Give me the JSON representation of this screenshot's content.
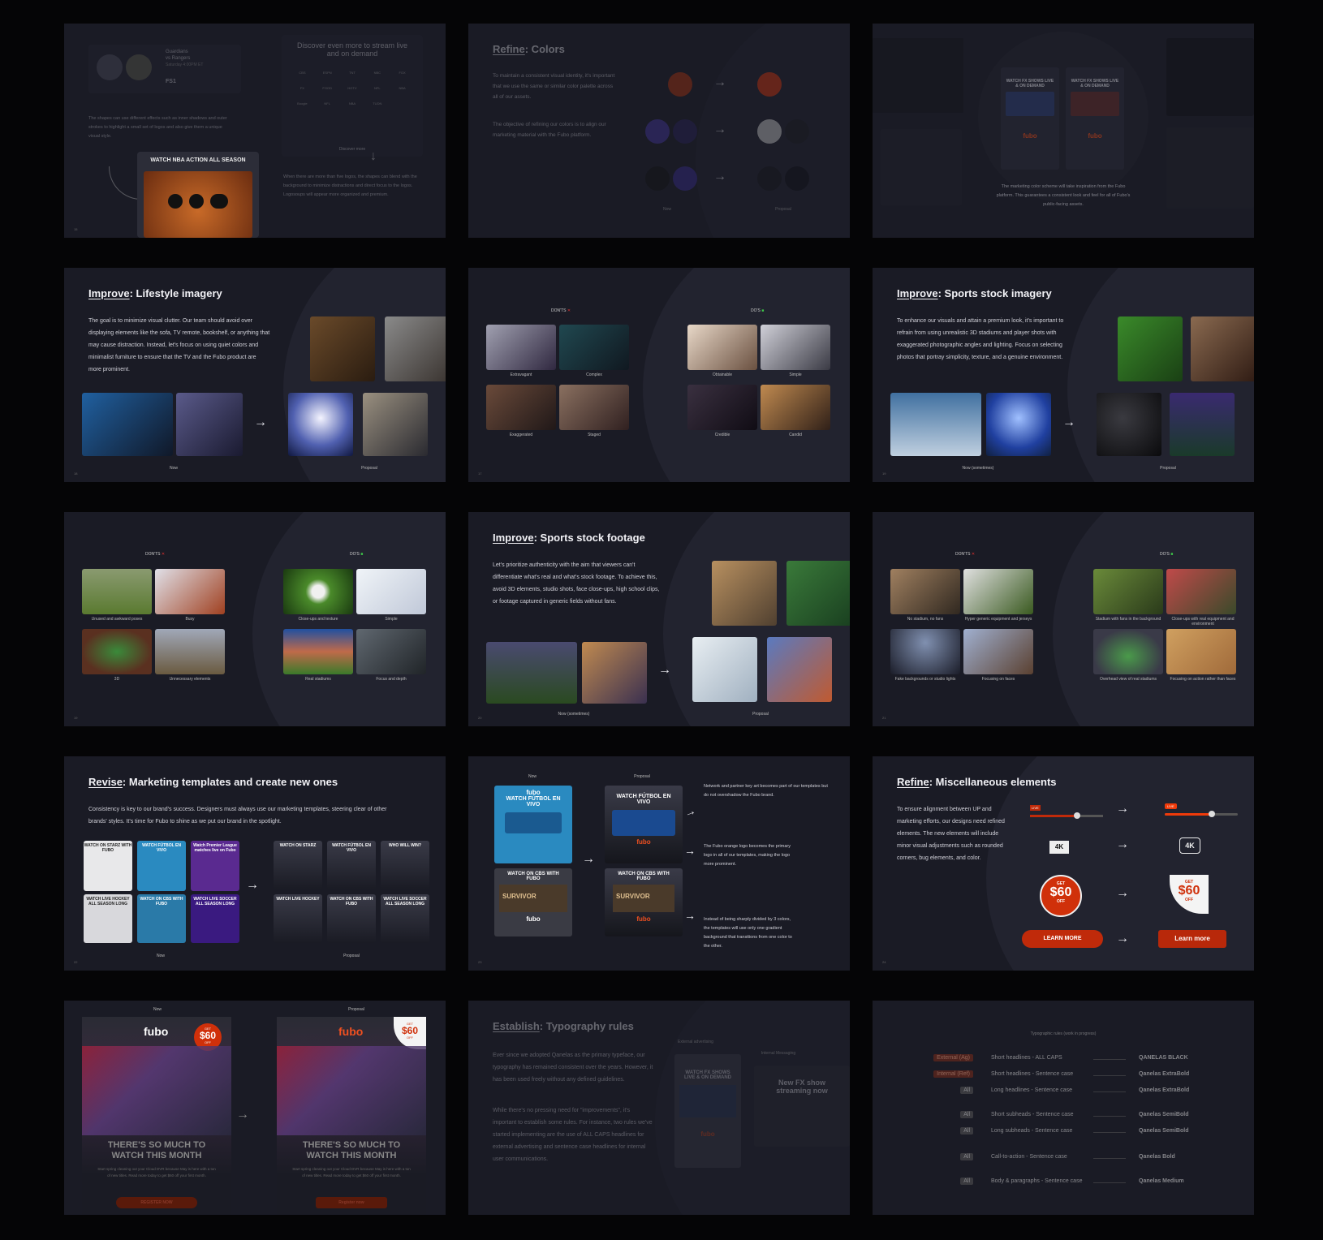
{
  "s1": {
    "game_line1": "Guardians",
    "game_line2": "vs Rangers",
    "game_time": "Saturday 4:00PM ET",
    "network": "FS1",
    "discover_title": "Discover even more to stream live and on demand",
    "discover_link": "Discover more",
    "shapes_text": "The shapes can use different effects such as inner shadows and outer strokes to highlight a small set of logos and also give them a unique visual style.",
    "nba_label": "WATCH NBA ACTION ALL SEASON",
    "blend_text": "When there are more than five logos, the shapes can blend with the background to minimize distractions and direct focus to the logos. Logosoups will appear more organized and premium.",
    "logo_labels": [
      "CBS",
      "ESPN",
      "TNT",
      "NBC",
      "FOX",
      "FX",
      "FOOD",
      "HGTV",
      "NFL",
      "NBA",
      "Boogie",
      "NFL",
      "NBA",
      "TUDN"
    ]
  },
  "s2": {
    "title_prefix": "Refine",
    "title_suffix": ": Colors",
    "p1": "To maintain a consistent visual identity, it's important that we use the same or similar color palette across all of our assets.",
    "p2": "The objective of refining our colors is to align our marketing material with the Fubo platform.",
    "now_label": "Now",
    "proposal_label": "Proposal"
  },
  "s3": {
    "watch_fx": "WATCH FX SHOWS LIVE & ON DEMAND",
    "brand": "fubo",
    "caption": "The marketing color scheme will take inspiration from the Fubo platform. This guarantees a consistent look and feel for all of Fubo's public-facing assets."
  },
  "s4": {
    "title_prefix": "Improve",
    "title_suffix": ": Lifestyle imagery",
    "body": "The goal is to minimize visual clutter. Our team should avoid over displaying elements like the sofa, TV remote, bookshelf, or anything that may cause distraction. Instead, let's focus on using quiet colors and minimalist furniture to ensure that the TV and the Fubo product are more prominent.",
    "now_label": "Now",
    "proposal_label": "Proposal"
  },
  "s5": {
    "donts": "DON'TS",
    "dos": "DO'S",
    "captions_bad": [
      "Extravagant",
      "Complex",
      "Exaggerated",
      "Staged"
    ],
    "captions_good": [
      "Obtainable",
      "Simple",
      "Credible",
      "Candid"
    ]
  },
  "s6": {
    "title_prefix": "Improve",
    "title_suffix": ": Sports stock imagery",
    "body": "To enhance our visuals and attain a premium look, it's important to refrain from using unrealistic 3D stadiums and player shots with exaggerated photographic angles and lighting. Focus on selecting photos that portray simplicity, texture, and a genuine environment.",
    "now_label": "Now (sometimes)",
    "proposal_label": "Proposal"
  },
  "s7": {
    "donts": "DON'TS",
    "dos": "DO'S",
    "captions_bad": [
      "Unused and awkward poses",
      "Busy",
      "3D",
      "Unnecessary elements"
    ],
    "captions_good": [
      "Close-ups and texture",
      "Simple",
      "Real stadiums",
      "Focus and depth"
    ]
  },
  "s8": {
    "title_prefix": "Improve",
    "title_suffix": ": Sports stock footage",
    "body": "Let's prioritize authenticity with the aim that viewers can't differentiate what's real and what's stock footage. To achieve this, avoid 3D elements, studio shots, face close-ups, high school clips, or footage captured in generic fields without fans.",
    "now_label": "Now (sometimes)",
    "proposal_label": "Proposal"
  },
  "s9": {
    "donts": "DON'TS",
    "dos": "DO'S",
    "captions_bad": [
      "No stadium, no fans",
      "Hyper generic equipment and jerseys",
      "Fake backgrounds or studio lights",
      "Focusing on faces"
    ],
    "captions_good": [
      "Stadium with fans in the background",
      "Close-ups with real equipment and environment",
      "Overhead view of real stadiums",
      "Focusing on action rather than faces"
    ]
  },
  "s10": {
    "title_prefix": "Revise",
    "title_suffix": ": Marketing templates and create new ones",
    "body": "Consistency is key to our brand's success. Designers must always use our marketing templates, steering clear of other brands' styles. It's time for Fubo to shine as we put our brand in the spotlight.",
    "now_label": "Now",
    "proposal_label": "Proposal",
    "tiles_now": [
      "WATCH ON STARZ WITH FUBO",
      "WATCH FÚTBOL EN VIVO",
      "Watch Premier League matches live on Fubo",
      "WATCH LIVE HOCKEY ALL SEASON LONG",
      "WATCH ON CBS WITH FUBO",
      "WATCH LIVE SOCCER ALL SEASON LONG"
    ],
    "tiles_prop": [
      "WATCH ON STARZ",
      "WATCH FÚTBOL EN VIVO",
      "WHO WILL WIN?",
      "WATCH LIVE HOCKEY",
      "WATCH ON CBS WITH FUBO",
      "WATCH LIVE SOCCER ALL SEASON LONG"
    ]
  },
  "s11": {
    "now_label": "Now",
    "proposal_label": "Proposal",
    "futbol": "WATCH FÚTBOL EN VIVO",
    "cbs": "WATCH ON CBS WITH FUBO",
    "survivor": "SURVIVOR",
    "brand": "fubo",
    "note1": "Network and partner key art becomes part of our templates but do not overshadow the Fubo brand.",
    "note2": "The Fubo orange logo becomes the primary logo in all of our templates, making the logo more prominent.",
    "note3": "Instead of being sharply divided by 3 colors, the templates will use only one gradient background that transitions from one color to the other."
  },
  "s12": {
    "title_prefix": "Refine",
    "title_suffix": ": Miscellaneous elements",
    "body": "To ensure alignment between UP and marketing efforts, our designs need refined elements. The new elements will include minor visual adjustments such as rounded corners, bug elements, and color.",
    "live": "LIVE",
    "badge": "4K",
    "get": "GET",
    "amount": "$60",
    "off": "OFF",
    "btn_now": "LEARN MORE",
    "btn_prop": "Learn more"
  },
  "s13": {
    "now_label": "Now",
    "proposal_label": "Proposal",
    "brand": "fubo",
    "headline": "THERE'S SO MUCH TO WATCH THIS MONTH",
    "sub": "Start spring cleaning out your Cloud DVR because May is here with a ton of new titles. Read more today to get $60 off your first month.",
    "cta": "REGISTER NOW",
    "cta2": "Register now",
    "get": "GET",
    "amount": "$60",
    "off": "OFF"
  },
  "s14": {
    "title_prefix": "Establish",
    "title_suffix": ": Typography rules",
    "p1": "Ever since we adopted Qanelas as the primary typeface, our typography has remained consistent over the years. However, it has been used freely without any defined guidelines.",
    "p2": "While there's no pressing need for \"improvements\", it's important to establish some rules. For instance, two rules we've started implementing are the use of ALL CAPS headlines for external advertising and sentence case headlines for internal user communications.",
    "ext_label": "External advertising",
    "int_label": "Internal Messaging",
    "fx_title": "WATCH FX SHOWS LIVE & ON DEMAND",
    "new_fx": "New FX show streaming now",
    "brand": "fubo"
  },
  "s15": {
    "header": "Typographic rules (work in progress)",
    "rows": [
      {
        "tag": "External (Ag)",
        "rule": "Short headlines - ALL CAPS",
        "font": "QANELAS BLACK"
      },
      {
        "tag": "Internal (Ref)",
        "rule": "Short headlines - Sentence case",
        "font": "Qanelas ExtraBold"
      },
      {
        "tag": "All",
        "rule": "Long headlines - Sentence case",
        "font": "Qanelas ExtraBold"
      },
      {
        "tag": "All",
        "rule": "Short subheads - Sentence case",
        "font": "Qanelas SemiBold"
      },
      {
        "tag": "All",
        "rule": "Long subheads - Sentence case",
        "font": "Qanelas SemiBold"
      },
      {
        "tag": "All",
        "rule": "Call-to-action - Sentence case",
        "font": "Qanelas Bold"
      },
      {
        "tag": "All",
        "rule": "Body & paragraphs - Sentence case",
        "font": "Qanelas Medium"
      }
    ]
  }
}
